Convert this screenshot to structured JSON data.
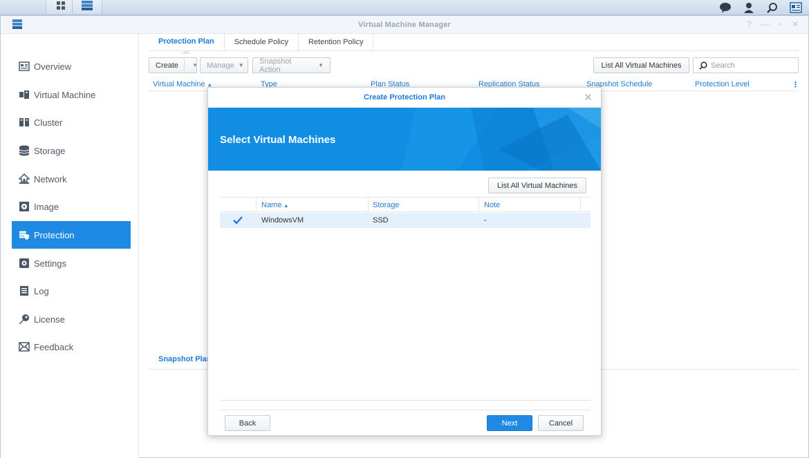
{
  "window": {
    "title": "Virtual Machine Manager"
  },
  "sidebar": {
    "items": [
      {
        "label": "Overview",
        "icon": "overview-icon"
      },
      {
        "label": "Virtual Machine",
        "icon": "virtual-machine-icon"
      },
      {
        "label": "Cluster",
        "icon": "cluster-icon"
      },
      {
        "label": "Storage",
        "icon": "storage-icon"
      },
      {
        "label": "Network",
        "icon": "network-icon"
      },
      {
        "label": "Image",
        "icon": "image-icon"
      },
      {
        "label": "Protection",
        "icon": "protection-icon",
        "active": true
      },
      {
        "label": "Settings",
        "icon": "gear-icon"
      },
      {
        "label": "Log",
        "icon": "log-icon"
      },
      {
        "label": "License",
        "icon": "key-icon"
      },
      {
        "label": "Feedback",
        "icon": "mail-icon"
      }
    ]
  },
  "main": {
    "tabs": [
      {
        "label": "Protection Plan",
        "active": true
      },
      {
        "label": "Schedule Policy"
      },
      {
        "label": "Retention Policy"
      }
    ],
    "toolbar": {
      "create": "Create",
      "manage": "Manage",
      "snapshot_action": "Snapshot Action",
      "list_all": "List All Virtual Machines",
      "search_placeholder": "Search"
    },
    "columns": [
      "Virtual Machine",
      "Type",
      "Plan Status",
      "Replication Status",
      "Snapshot Schedule",
      "Protection Level"
    ],
    "lower_tab": "Snapshot Plan"
  },
  "modal": {
    "title": "Create Protection Plan",
    "banner_title": "Select Virtual Machines",
    "list_all": "List All Virtual Machines",
    "columns": [
      "Name",
      "Storage",
      "Note"
    ],
    "rows": [
      {
        "name": "WindowsVM",
        "storage": "SSD",
        "note": "-",
        "checked": true
      }
    ],
    "back": "Back",
    "next": "Next",
    "cancel": "Cancel"
  },
  "colors": {
    "accent": "#1f8ae3",
    "link": "#1f7ad6",
    "banner": "#118ee3"
  }
}
